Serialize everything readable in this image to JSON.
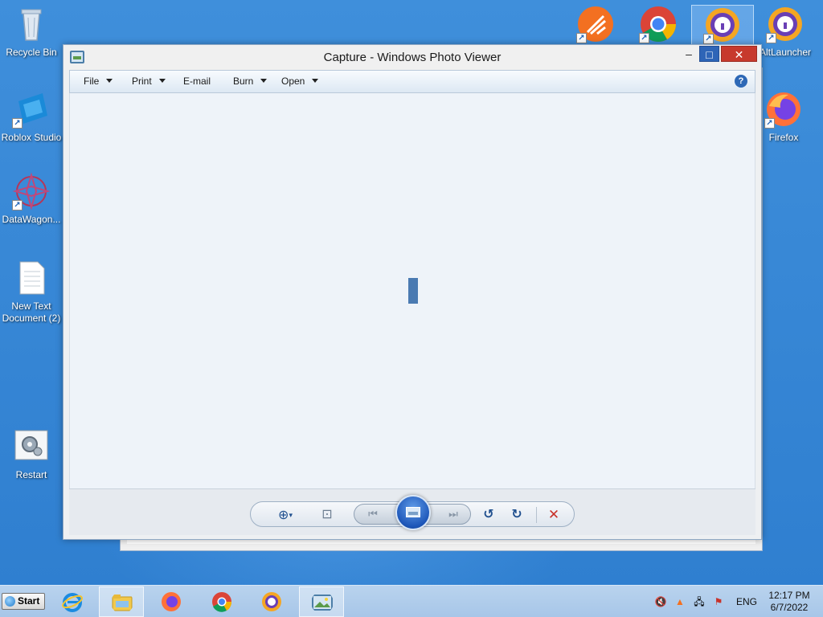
{
  "desktop": {
    "icons_left": [
      {
        "label": "Recycle Bin"
      },
      {
        "label": "Roblox Studio"
      },
      {
        "label": "DataWagon..."
      },
      {
        "label": "New Text Document (2)"
      },
      {
        "label": "Restart"
      }
    ],
    "icons_right": [
      {
        "label": "AltLauncher"
      },
      {
        "label": "Firefox"
      }
    ]
  },
  "window": {
    "title": "Capture - Windows Photo Viewer",
    "minimize": "–",
    "maximize": "□",
    "close": "✕",
    "menu": {
      "file": "File",
      "print": "Print",
      "email": "E-mail",
      "burn": "Burn",
      "open": "Open",
      "help": "?"
    }
  },
  "controls": {
    "zoom": "⊕",
    "fit": "⊡",
    "prev": "⏮",
    "next": "⏭",
    "rotate_ccw": "↺",
    "rotate_cw": "↻",
    "delete": "✕"
  },
  "taskbar": {
    "start_label": "Start",
    "language": "ENG",
    "time": "12:17 PM",
    "date": "6/7/2022"
  },
  "colors": {
    "accent": "#2e65b7",
    "close": "#c7392d",
    "desktop": "#3a8ad6"
  }
}
